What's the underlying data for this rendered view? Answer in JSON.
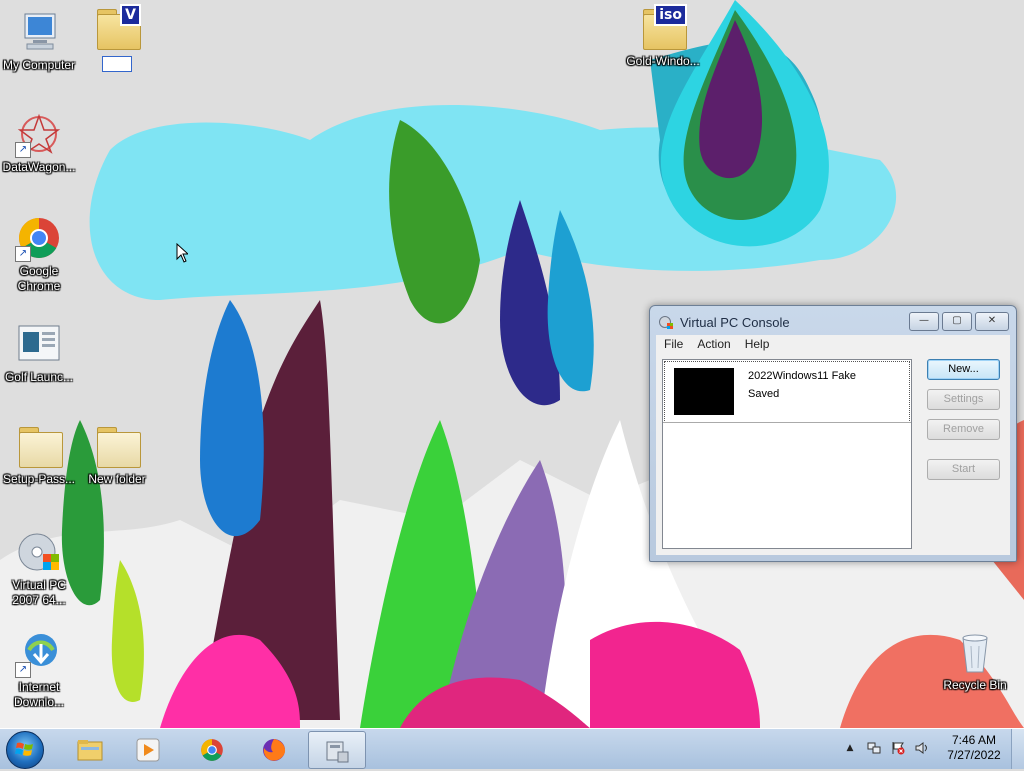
{
  "desktop": {
    "icons": [
      {
        "label": "My Computer",
        "icon": "computer-icon"
      },
      {
        "label": "",
        "icon": "folder-v-icon"
      },
      {
        "label": "Gold-Windo...",
        "icon": "iso-folder-icon",
        "badge": "iso"
      },
      {
        "label": "DataWagon...",
        "icon": "datawagon-icon"
      },
      {
        "label": "Google\nChrome",
        "icon": "chrome-icon"
      },
      {
        "label": "Golf Launc...",
        "icon": "golf-launcher-icon"
      },
      {
        "label": "Setup-Pass...",
        "icon": "folder-icon"
      },
      {
        "label": "New folder",
        "icon": "folder-icon"
      },
      {
        "label": "Virtual PC\n2007 64...",
        "icon": "virtual-pc-icon"
      },
      {
        "label": "Internet\nDownlo...",
        "icon": "internet-download-manager-icon"
      },
      {
        "label": "Recycle Bin",
        "icon": "recycle-bin-icon"
      }
    ],
    "folder_v_badge": "V"
  },
  "window": {
    "title": "Virtual PC Console",
    "caption_buttons": {
      "minimize": "—",
      "maximize": "▢",
      "close": "✕"
    },
    "menu": [
      "File",
      "Action",
      "Help"
    ],
    "vm": {
      "name": "2022Windows11 Fake",
      "status": "Saved"
    },
    "buttons": {
      "new": "New...",
      "settings": "Settings",
      "remove": "Remove",
      "start": "Start"
    }
  },
  "taskbar": {
    "items": [
      "start-orb",
      "file-explorer-icon",
      "media-player-icon",
      "chrome-icon",
      "firefox-icon",
      "virtual-pc-console-icon"
    ],
    "tray": {
      "show_hidden": "▲",
      "network": "network-icon",
      "action_center": "flag-icon",
      "volume": "speaker-icon"
    },
    "clock": {
      "time": "7:46 AM",
      "date": "7/27/2022"
    }
  },
  "colors": {
    "accent": "#3c7fb1",
    "taskbar": "#b7cce4",
    "window_frame": "#c2d3e7"
  }
}
